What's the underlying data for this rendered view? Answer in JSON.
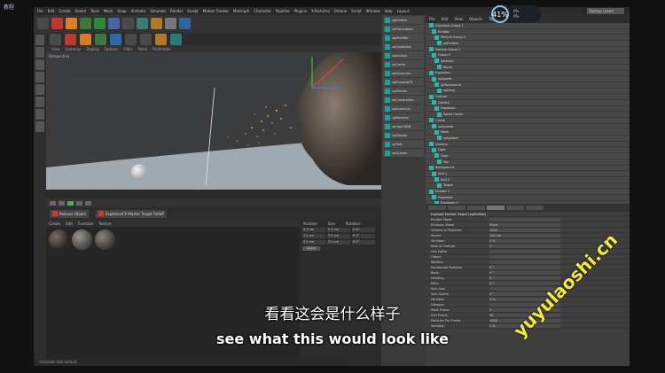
{
  "overlay": {
    "logo_text": "教程",
    "hud_percent": "41%",
    "hud_line1": "0%",
    "hud_line2": "0%",
    "subtitle_cn": "看看这会是什么样子",
    "subtitle_en": "see what this would look like",
    "watermark": "yuyulaoshi.cn"
  },
  "menubar": {
    "items": [
      "File",
      "Edit",
      "Create",
      "Select",
      "Tools",
      "Mesh",
      "Snap",
      "Animate",
      "Simulate",
      "Render",
      "Sculpt",
      "Motion Tracker",
      "MoGraph",
      "Character",
      "Pipeline",
      "Plugins",
      "X-Particles",
      "Octane",
      "Script",
      "Window",
      "Help"
    ],
    "layout_label": "Layout:",
    "layout_value": "Startup (User)"
  },
  "viewport": {
    "label": "Perspective",
    "menu": [
      "View",
      "Cameras",
      "Display",
      "Options",
      "Filter",
      "Panel",
      "ProRender"
    ]
  },
  "buttons": {
    "record_1": "Release Object",
    "record_2": "ExplosionFX Master Target Falloff"
  },
  "material_panel": {
    "menu": [
      "Create",
      "Edit",
      "Function",
      "Texture"
    ]
  },
  "coord_panel": {
    "headers": [
      "Position",
      "Size",
      "Rotation"
    ],
    "rows": [
      {
        "a": "X 0 cm",
        "b": "X 0 cm",
        "c": "H 0°"
      },
      {
        "a": "Y 0 cm",
        "b": "Y 0 cm",
        "c": "P 0°"
      },
      {
        "a": "Z 0 cm",
        "b": "Z 0 cm",
        "c": "B 0°"
      }
    ],
    "apply_label": "Apply"
  },
  "midpanel": {
    "items": [
      "xpEmitter",
      "xpGenerators",
      "xpModifier",
      "xpQuestions",
      "xpActions",
      "xpCache",
      "xpDynamics",
      "xpExplosiaFX",
      "xpSkinner",
      "xpConstraints",
      "xpSpherical",
      "xpMaterial",
      "xpOpenVDB",
      "xpDisplay",
      "xpTrail",
      "xpSystem"
    ]
  },
  "object_panel": {
    "tabs": [
      "File",
      "Edit",
      "View",
      "Objects",
      "Tags",
      "Bookmarks"
    ],
    "rows": [
      "Explosion Group 1",
      "Emitter",
      "Particle Group 1",
      "xpEmitter",
      "Particle Group 2",
      "Group 3",
      "Asteroid",
      "Rocks",
      "Explosion",
      "xpSpeed",
      "xpTurbulence",
      "xpDrag",
      "Collider",
      "Gravity",
      "Explosion",
      "Rocks Cache",
      "Cache",
      "xpSystem",
      "Mesh",
      "xpSphere",
      "Camera",
      "Light",
      "Floor",
      "Sky",
      "Background",
      "Null 1",
      "Null 2",
      "Target",
      "Emitter 2",
      "Fragment",
      "Explosion.1"
    ]
  },
  "attr_panel": {
    "title": "Explosia Emitter Object [xpEmitter]",
    "rows": [
      {
        "label": "Emitter Mode",
        "value": ""
      },
      {
        "label": "Emission Mode",
        "value": "Pulse"
      },
      {
        "label": "Number of Particles",
        "value": "1000"
      },
      {
        "label": "Speed",
        "value": "100 cm"
      },
      {
        "label": "Variation",
        "value": "0 %"
      },
      {
        "label": "Rate of Change",
        "value": "0"
      },
      {
        "label": "Use Spline",
        "value": ""
      },
      {
        "label": "Object",
        "value": ""
      },
      {
        "label": "Rotation",
        "value": ""
      },
      {
        "label": "Randomise Rotation",
        "value": "0 °"
      },
      {
        "label": "Bank",
        "value": "0 °"
      },
      {
        "label": "Heading",
        "value": "0 °"
      },
      {
        "label": "Pitch",
        "value": "0 °"
      },
      {
        "label": "Spin Axis",
        "value": ""
      },
      {
        "label": "Spin Speed",
        "value": "0 °"
      },
      {
        "label": "Variation",
        "value": "0 %"
      },
      {
        "label": "Lifespan",
        "value": ""
      },
      {
        "label": "Start Frame",
        "value": "0"
      },
      {
        "label": "End Frame",
        "value": "90"
      },
      {
        "label": "Particles Per Frame",
        "value": "1000"
      },
      {
        "label": "Variation",
        "value": "0 %"
      }
    ]
  },
  "statusbar": {
    "text": "Unknown Ask-default"
  },
  "colors": {
    "accent_teal": "#1aa39e",
    "record_red": "#d13b2b",
    "watermark_yellow": "#f3ec3a"
  }
}
